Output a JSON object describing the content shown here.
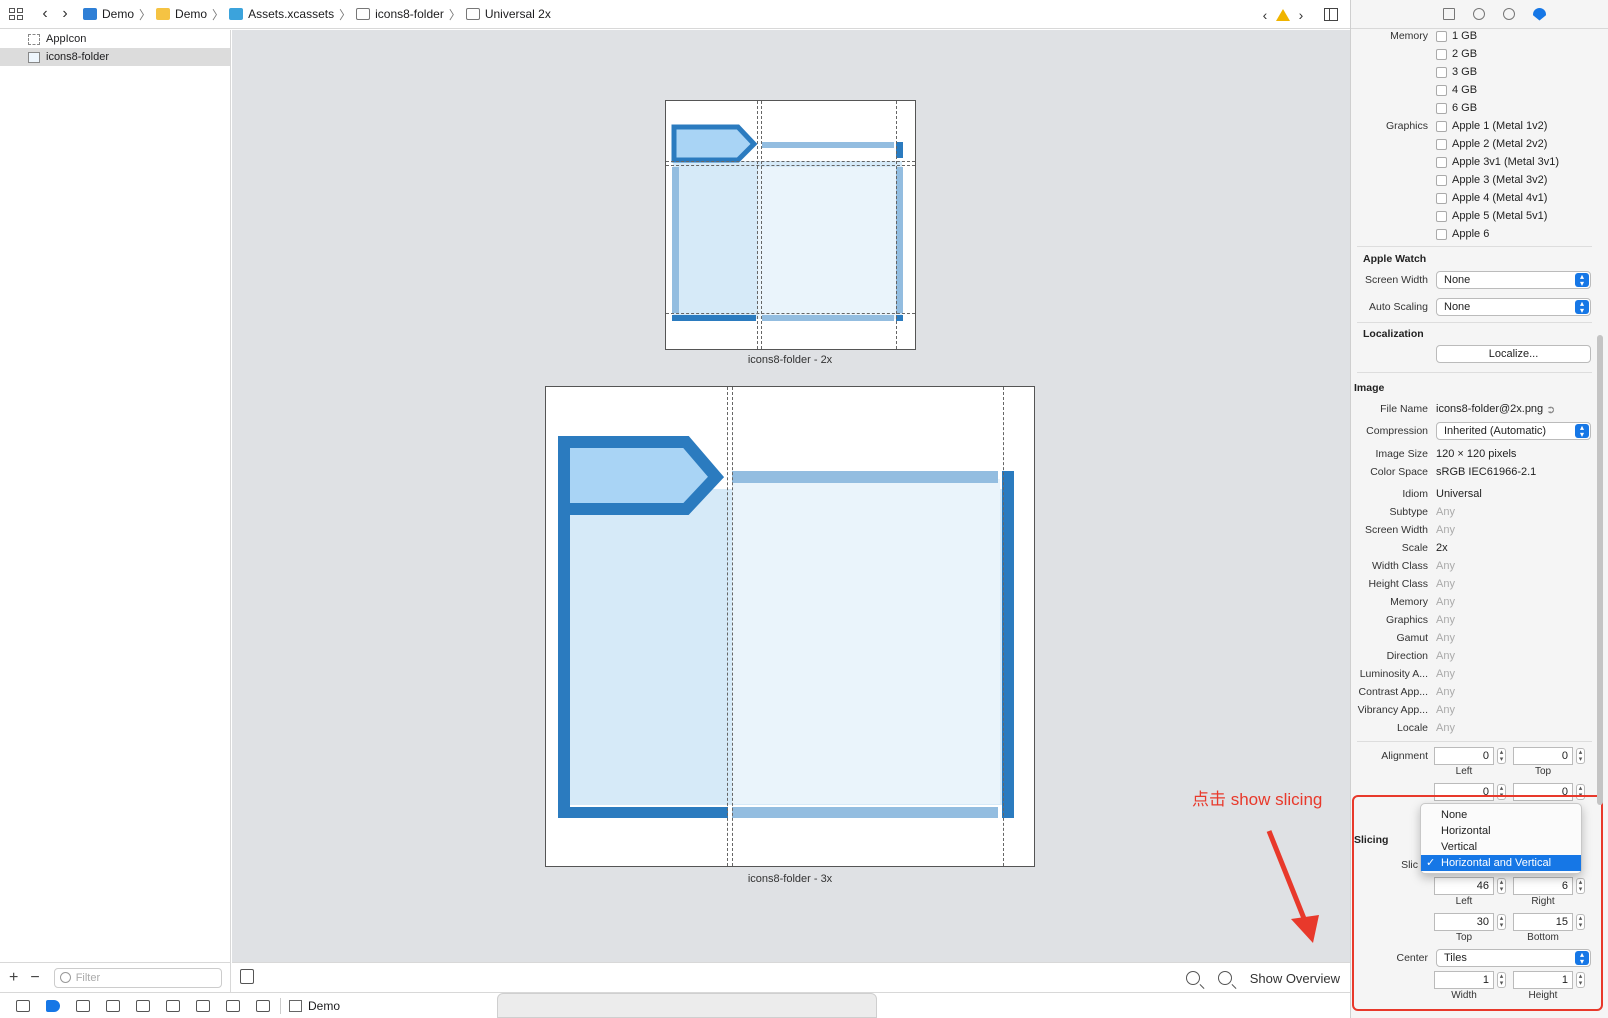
{
  "breadcrumbs": [
    {
      "label": "Demo",
      "icon": "project-file-icon"
    },
    {
      "label": "Demo",
      "icon": "folder-icon"
    },
    {
      "label": "Assets.xcassets",
      "icon": "asset-catalog-icon"
    },
    {
      "label": "icons8-folder",
      "icon": "image-set-icon"
    },
    {
      "label": "Universal 2x",
      "icon": "image-slot-icon"
    }
  ],
  "navigator": {
    "items": [
      {
        "label": "AppIcon",
        "selected": false
      },
      {
        "label": "icons8-folder",
        "selected": true
      }
    ],
    "filter_placeholder": "Filter"
  },
  "canvas": {
    "label_2x": "icons8-folder - 2x",
    "label_3x": "icons8-folder - 3x",
    "show_overview": "Show Overview",
    "annotation": "点击 show slicing"
  },
  "debugbar": {
    "scheme": "Demo"
  },
  "inspector": {
    "memory_label": "Memory",
    "memory_options": [
      "1 GB",
      "2 GB",
      "3 GB",
      "4 GB",
      "6 GB"
    ],
    "graphics_label": "Graphics",
    "graphics_options": [
      "Apple 1 (Metal 1v2)",
      "Apple 2 (Metal 2v2)",
      "Apple 3v1 (Metal 3v1)",
      "Apple 3 (Metal 3v2)",
      "Apple 4 (Metal 4v1)",
      "Apple 5 (Metal 5v1)",
      "Apple 6"
    ],
    "apple_watch": {
      "title": "Apple Watch",
      "screen_width_label": "Screen Width",
      "screen_width": "None",
      "auto_scaling_label": "Auto Scaling",
      "auto_scaling": "None"
    },
    "localization": {
      "title": "Localization",
      "button": "Localize..."
    },
    "image": {
      "title": "Image",
      "file_name_label": "File Name",
      "file_name": "icons8-folder@2x.png",
      "compression_label": "Compression",
      "compression": "Inherited (Automatic)",
      "image_size_label": "Image Size",
      "image_size": "120 × 120 pixels",
      "color_space_label": "Color Space",
      "color_space": "sRGB IEC61966-2.1"
    },
    "props": [
      {
        "label": "Idiom",
        "value": "Universal",
        "dim": false
      },
      {
        "label": "Subtype",
        "value": "Any",
        "dim": true
      },
      {
        "label": "Screen Width",
        "value": "Any",
        "dim": true
      },
      {
        "label": "Scale",
        "value": "2x",
        "dim": false
      },
      {
        "label": "Width Class",
        "value": "Any",
        "dim": true
      },
      {
        "label": "Height Class",
        "value": "Any",
        "dim": true
      },
      {
        "label": "Memory",
        "value": "Any",
        "dim": true
      },
      {
        "label": "Graphics",
        "value": "Any",
        "dim": true
      },
      {
        "label": "Gamut",
        "value": "Any",
        "dim": true
      },
      {
        "label": "Direction",
        "value": "Any",
        "dim": true
      },
      {
        "label": "Luminosity A...",
        "value": "Any",
        "dim": true
      },
      {
        "label": "Contrast App...",
        "value": "Any",
        "dim": true
      },
      {
        "label": "Vibrancy App...",
        "value": "Any",
        "dim": true
      },
      {
        "label": "Locale",
        "value": "Any",
        "dim": true
      }
    ],
    "alignment": {
      "label": "Alignment",
      "left": "0",
      "top": "0",
      "bottom": "0",
      "right": "0",
      "left_label": "Left",
      "top_label": "Top"
    },
    "slicing": {
      "title": "Slicing",
      "slices_label": "Slic",
      "menu": [
        "None",
        "Horizontal",
        "Vertical",
        "Horizontal and Vertical"
      ],
      "selected": "Horizontal and Vertical",
      "left": "46",
      "right": "6",
      "top": "30",
      "bottom": "15",
      "left_label": "Left",
      "right_label": "Right",
      "top_label": "Top",
      "bottom_label": "Bottom",
      "center_label": "Center",
      "center": "Tiles",
      "width": "1",
      "height": "1",
      "width_label": "Width",
      "height_label": "Height"
    }
  },
  "colors": {
    "accent": "#1677e6",
    "annotation": "#e8392b",
    "folder_dark": "#2b7bbf",
    "folder_light": "#d6eaf8",
    "folder_tab": "#a9d4f5"
  }
}
